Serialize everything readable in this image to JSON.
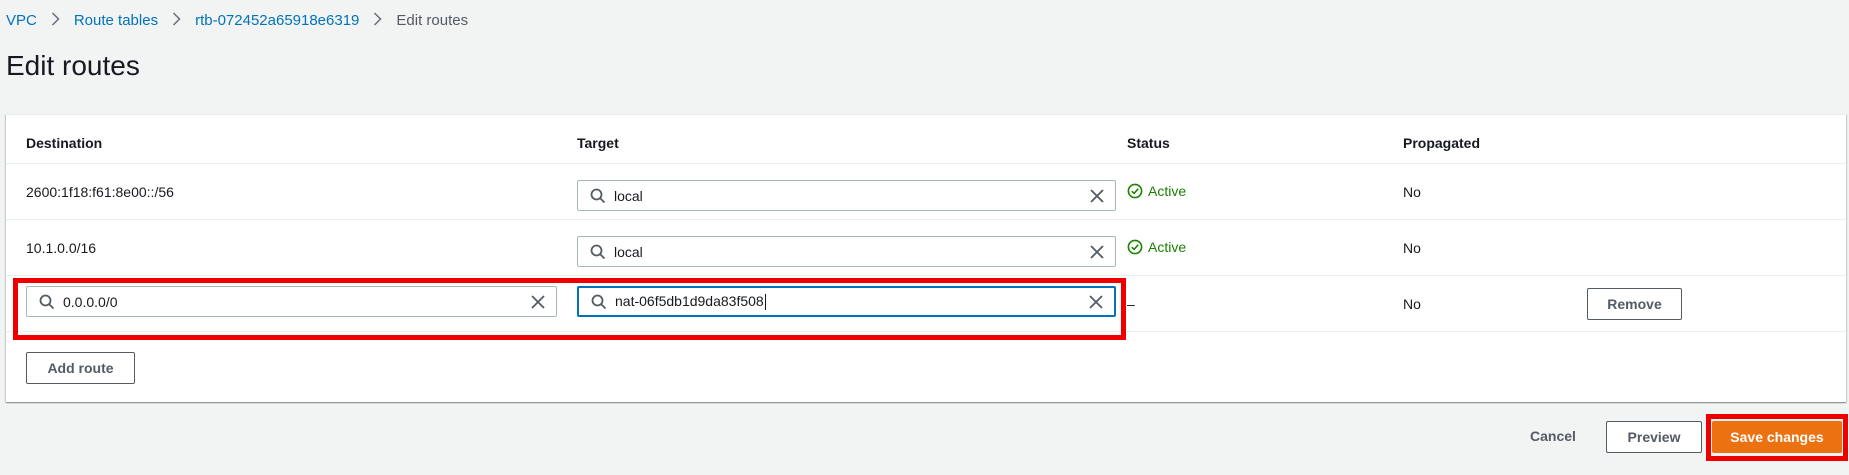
{
  "breadcrumb": {
    "items": [
      "VPC",
      "Route tables",
      "rtb-072452a65918e6319"
    ],
    "current": "Edit routes"
  },
  "page_title": "Edit routes",
  "table": {
    "headers": {
      "destination": "Destination",
      "target": "Target",
      "status": "Status",
      "propagated": "Propagated"
    },
    "rows": [
      {
        "destination": "2600:1f18:f61:8e00::/56",
        "target": "local",
        "status": "Active",
        "propagated": "No"
      },
      {
        "destination": "10.1.0.0/16",
        "target": "local",
        "status": "Active",
        "propagated": "No"
      },
      {
        "destination": "0.0.0.0/0",
        "target": "nat-06f5db1d9da83f508",
        "status": "–",
        "propagated": "No",
        "remove_label": "Remove"
      }
    ],
    "add_route_label": "Add route"
  },
  "footer": {
    "cancel_label": "Cancel",
    "preview_label": "Preview",
    "save_label": "Save changes"
  },
  "colors": {
    "link": "#0073bb",
    "active": "#1d8102",
    "primary": "#ec7211",
    "highlight": "#ee0000"
  }
}
